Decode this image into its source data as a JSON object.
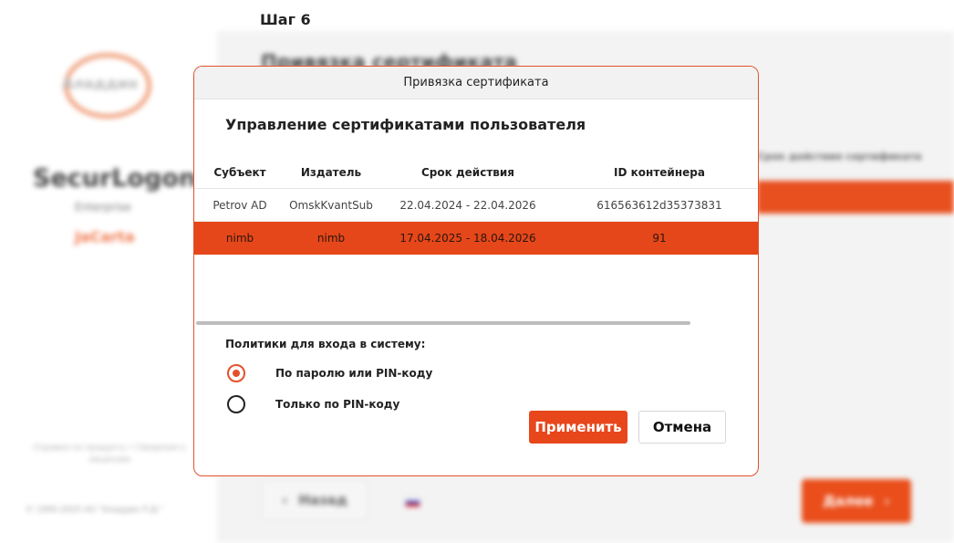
{
  "background": {
    "step_label": "Шаг 6",
    "main_title": "Привязка сертификата",
    "logo_text": "Аладдин",
    "product_name": "SecurLogon",
    "product_edition": "Enterprise",
    "product_tag": "JaCarta",
    "side_note": "Справка по продукту • Сведения о лицензии",
    "side_copyright": "© 1995-2025 АО \"Аладдин Р.Д.\"",
    "main_column_label": "Срок действия сертификата",
    "back_label": "Назад",
    "next_label": "Далее"
  },
  "dialog": {
    "title": "Привязка сертификата",
    "heading": "Управление сертификатами пользователя",
    "columns": [
      "Субъект",
      "Издатель",
      "Срок действия",
      "ID контейнера"
    ],
    "rows": [
      {
        "subject": "Petrov AD",
        "issuer": "OmskKvantSub",
        "validity": "22.04.2024 - 22.04.2026",
        "container_id": "616563612d35373831",
        "selected": false
      },
      {
        "subject": "nimb",
        "issuer": "nimb",
        "validity": "17.04.2025 - 18.04.2026",
        "container_id": "91",
        "selected": true
      }
    ],
    "policy_label": "Политики для входа в систему:",
    "policies": [
      {
        "label": "По паролю или PIN-коду",
        "checked": true
      },
      {
        "label": "Только по PIN-коду",
        "checked": false
      }
    ],
    "apply_label": "Применить",
    "cancel_label": "Отмена"
  },
  "colors": {
    "accent": "#e8461b",
    "dialog_border": "#e2502b"
  },
  "icons": {
    "back": "chevron-left-icon",
    "next": "chevron-right-icon",
    "language": "russian-flag-icon"
  }
}
